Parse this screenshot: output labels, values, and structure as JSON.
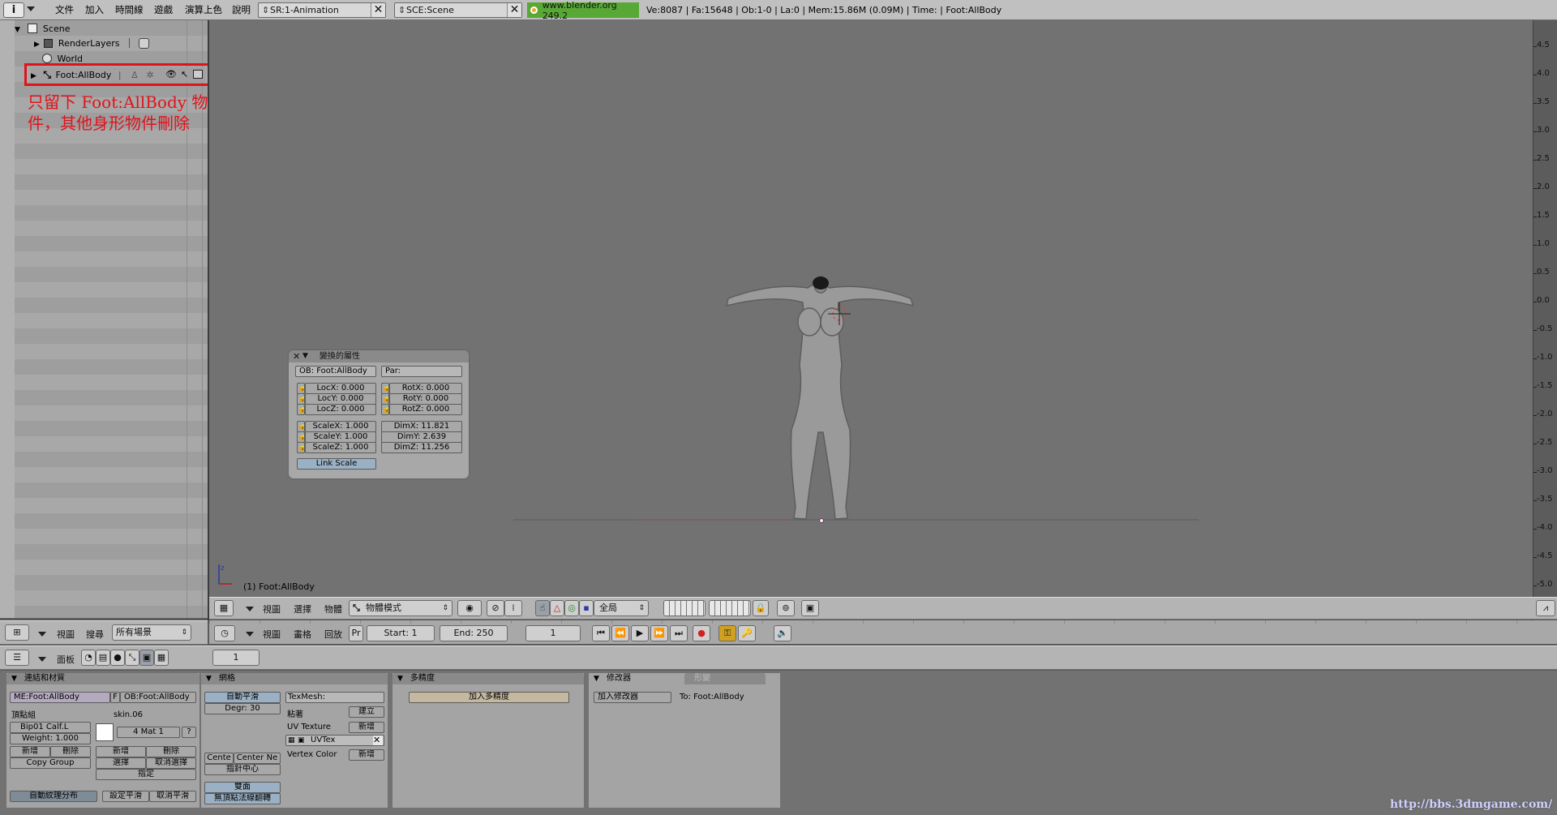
{
  "topbar": {
    "menus": [
      "文件",
      "加入",
      "時間線",
      "遊戲",
      "演算上色",
      "說明"
    ],
    "screen": "SR:1-Animation",
    "scene": "SCE:Scene",
    "website": "www.blender.org 249.2",
    "stats": "Ve:8087 | Fa:15648 | Ob:1-0 | La:0  | Mem:15.86M (0.09M)  | Time: | Foot:AllBody"
  },
  "outliner": {
    "scene": "Scene",
    "renderlayers": "RenderLayers",
    "world": "World",
    "object": "Foot:AllBody",
    "annotation_line1": "只留下 Foot:AllBody 物",
    "annotation_line2": "件，其他身形物件刪除",
    "annotation_color": "#e0131a",
    "header": {
      "view": "視圖",
      "search": "搜尋",
      "scope": "所有場景"
    }
  },
  "transform_panel": {
    "title": "變換的屬性",
    "ob": "OB: Foot:AllBody",
    "par": "Par:",
    "loc": [
      "LocX: 0.000",
      "LocY: 0.000",
      "LocZ: 0.000"
    ],
    "rot": [
      "RotX: 0.000",
      "RotY: 0.000",
      "RotZ: 0.000"
    ],
    "scale": [
      "ScaleX: 1.000",
      "ScaleY: 1.000",
      "ScaleZ: 1.000"
    ],
    "dim": [
      "DimX: 11.821",
      "DimY: 2.639",
      "DimZ: 11.256"
    ],
    "link_scale": "Link Scale"
  },
  "viewport": {
    "object_label": "(1) Foot:AllBody",
    "ruler_ticks": [
      "4.5",
      "4.0",
      "3.5",
      "3.0",
      "2.5",
      "2.0",
      "1.5",
      "1.0",
      "0.5",
      "0.0",
      "-0.5",
      "-1.0",
      "-1.5",
      "-2.0",
      "-2.5",
      "-3.0",
      "-3.5",
      "-4.0",
      "-4.5",
      "-5.0"
    ]
  },
  "view3d_header": {
    "view": "視圖",
    "select": "選擇",
    "object": "物體",
    "mode": "物體模式",
    "orientation": "全局"
  },
  "timeline_header": {
    "view": "視圖",
    "frame": "畫格",
    "playback": "回放",
    "pr": "Pr",
    "start": "Start: 1",
    "end": "End: 250",
    "current": "1"
  },
  "buttons_header": {
    "panels": "面板",
    "frame": "1"
  },
  "panels": {
    "link_materials": {
      "title": "連結和材質",
      "me": "ME:Foot:AllBody",
      "f": "F",
      "ob": "OB:Foot:AllBody",
      "vgroup_label": "頂點組",
      "material_name": "skin.06",
      "vgroup": "Bip01 Calf.L",
      "weight": "Weight: 1.000",
      "mat": "4 Mat 1",
      "question": "?",
      "new": "新增",
      "delete": "刪除",
      "copy_group": "Copy Group",
      "new2": "新增",
      "delete2": "刪除",
      "select": "選擇",
      "deselect": "取消選擇",
      "assign": "指定",
      "auto_tex": "自動紋理分布",
      "set_smooth": "設定平滑",
      "set_solid": "取消平滑"
    },
    "mesh": {
      "title": "網格",
      "autosmooth": "自動平滑",
      "degr": "Degr: 30",
      "centre": "Cente",
      "centre_new": "Center Ne",
      "centre_cursor": "指針中心",
      "double_sided": "雙面",
      "no_v_normal_flip": "無頂點法線翻轉",
      "texmesh": "TexMesh:",
      "sticky": "粘著",
      "make": "建立",
      "uv_texture": "UV Texture",
      "new_uv": "新增",
      "uvtex": "UVTex",
      "vertex_color": "Vertex Color",
      "new_vc": "新增"
    },
    "multires": {
      "title": "多精度",
      "add": "加入多精度"
    },
    "modifiers": {
      "tab1": "修改器",
      "tab2": "形變",
      "add": "加入修改器",
      "to": "To: Foot:AllBody"
    }
  },
  "watermark": "http://bbs.3dmgame.com/"
}
